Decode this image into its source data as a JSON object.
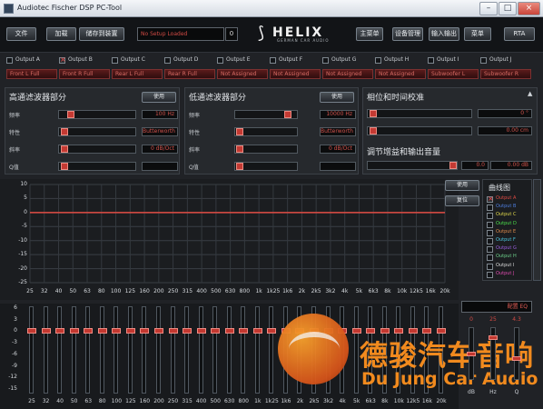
{
  "window": {
    "title": "Audiotec Fischer DSP PC-Tool",
    "minimize_symbol": "–",
    "maximize_symbol": "□",
    "close_symbol": "×"
  },
  "toolbar": {
    "buttons": [
      "文件",
      "加载",
      "储存到装置",
      "主菜单",
      "设备管理",
      "输入输出",
      "菜单",
      "RTA"
    ],
    "setup_name": "No Setup Loaded",
    "setup_number": "0"
  },
  "logo": {
    "brand": "HELIX",
    "subtitle": "GERMAN CAR AUDIO",
    "mark": "⟆"
  },
  "outputs": [
    {
      "label": "Output A",
      "checked": false
    },
    {
      "label": "Output B",
      "checked": true
    },
    {
      "label": "Output C",
      "checked": false
    },
    {
      "label": "Output D",
      "checked": false
    },
    {
      "label": "Output E",
      "checked": false
    },
    {
      "label": "Output F",
      "checked": false
    },
    {
      "label": "Output G",
      "checked": false
    },
    {
      "label": "Output H",
      "checked": false
    },
    {
      "label": "Output I",
      "checked": false
    },
    {
      "label": "Output J",
      "checked": false
    }
  ],
  "channel_tabs": [
    "Front L Full",
    "Front R Full",
    "Rear L Full",
    "Rear R Full",
    "Not Assigned",
    "Not Assigned",
    "Not Assigned",
    "Not Assigned",
    "Subwoofer L",
    "Subwoofer R"
  ],
  "highpass": {
    "title": "高通滤波器部分",
    "toggle": "使用",
    "rows": [
      {
        "label": "频率",
        "value": "100 Hz",
        "position": 0.12
      },
      {
        "label": "特性",
        "value": "Butterworth",
        "position": 0.02
      },
      {
        "label": "斜率",
        "value": "0 dB/Oct",
        "position": 0.02
      },
      {
        "label": "Q值",
        "value": "",
        "position": 0.02
      }
    ]
  },
  "lowpass": {
    "title": "低通滤波器部分",
    "toggle": "使用",
    "rows": [
      {
        "label": "频率",
        "value": "10000 Hz",
        "position": 0.9
      },
      {
        "label": "特性",
        "value": "Butterworth",
        "position": 0.02
      },
      {
        "label": "斜率",
        "value": "0 dB/Oct",
        "position": 0.02
      },
      {
        "label": "Q值",
        "value": "",
        "position": 0.02
      }
    ]
  },
  "phase_delay": {
    "title": "相位和时间校准",
    "collapse_symbol": "▲",
    "phase_value": "0 °",
    "delay_value": "0.00 cm",
    "gain_title": "调节增益和输出音量",
    "gain_value_left": "0.0",
    "gain_value_right": "0.00 dB"
  },
  "eq_graph": {
    "y_ticks": [
      "10",
      "5",
      "0",
      "-5",
      "-10",
      "-15",
      "-20",
      "-25"
    ],
    "x_ticks": [
      "25",
      "32",
      "40",
      "50",
      "63",
      "80",
      "100",
      "125",
      "160",
      "200",
      "250",
      "315",
      "400",
      "500",
      "630",
      "800",
      "1k",
      "1k25",
      "1k6",
      "2k",
      "2k5",
      "3k2",
      "4k",
      "5k",
      "6k3",
      "8k",
      "10k",
      "12k5",
      "16k",
      "20k"
    ]
  },
  "side_buttons": {
    "use": "使用",
    "reset": "复位"
  },
  "curves": {
    "title": "曲线图",
    "items": [
      {
        "label": "Output A",
        "color": "#e04b43",
        "checked": true
      },
      {
        "label": "Output B",
        "color": "#4f7fe0",
        "checked": false
      },
      {
        "label": "Output C",
        "color": "#e0d84b",
        "checked": false
      },
      {
        "label": "Output D",
        "color": "#4be04b",
        "checked": false
      },
      {
        "label": "Output E",
        "color": "#e08b4b",
        "checked": false
      },
      {
        "label": "Output F",
        "color": "#4bc8e0",
        "checked": false
      },
      {
        "label": "Output G",
        "color": "#9b5ee0",
        "checked": false
      },
      {
        "label": "Output H",
        "color": "#6ed28c",
        "checked": false
      },
      {
        "label": "Output I",
        "color": "#dddddd",
        "checked": false
      },
      {
        "label": "Output J",
        "color": "#e04bb0",
        "checked": false
      }
    ]
  },
  "band_sliders": {
    "y_ticks": [
      "6",
      "3",
      "0",
      "-3",
      "-6",
      "-9",
      "-12",
      "-15"
    ],
    "labels": [
      "25",
      "32",
      "40",
      "50",
      "63",
      "80",
      "100",
      "125",
      "160",
      "200",
      "250",
      "315",
      "400",
      "500",
      "630",
      "800",
      "1k",
      "1k25",
      "1k6",
      "2k",
      "2k5",
      "3k2",
      "4k",
      "5k",
      "6k3",
      "8k",
      "10k",
      "12k5",
      "16k",
      "20k"
    ],
    "gains_db": [
      0,
      0,
      0,
      0,
      0,
      0,
      0,
      0,
      0,
      0,
      0,
      0,
      0,
      0,
      0,
      0,
      0,
      0,
      0,
      0,
      0,
      0,
      0,
      0,
      0,
      0,
      0,
      0,
      0,
      0
    ]
  },
  "band_edit": {
    "selected": "配置 EQ",
    "values": [
      "0",
      "25",
      "4.3"
    ],
    "labels": [
      "dB",
      "Hz",
      "Q"
    ],
    "positions": [
      0.5,
      0.15,
      0.6
    ]
  },
  "watermark": {
    "chinese": "德骏汽车音响",
    "english": "Du Jung Car Audio"
  }
}
